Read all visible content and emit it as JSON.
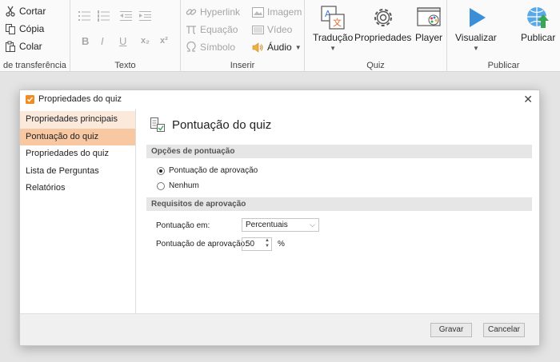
{
  "ribbon": {
    "clipboard": {
      "label": "de transferência",
      "cut": "Cortar",
      "copy": "Cópia",
      "paste": "Colar"
    },
    "text": {
      "label": "Texto",
      "bold": "B",
      "italic": "I",
      "underline": "U",
      "subscript": "x₂",
      "superscript": "x²"
    },
    "insert": {
      "label": "Inserir",
      "hyperlink": "Hyperlink",
      "equation": "Equação",
      "symbol": "Símbolo",
      "image": "Imagem",
      "video": "Vídeo",
      "audio": "Áudio"
    },
    "quiz": {
      "label": "Quiz",
      "translation": "Tradução",
      "properties": "Propriedades",
      "player": "Player"
    },
    "publish": {
      "label": "Publicar",
      "preview": "Visualizar",
      "publish": "Publicar"
    }
  },
  "dialog": {
    "title": "Propriedades do quiz",
    "sidebar": [
      "Propriedades principais",
      "Pontuação do quiz",
      "Propriedades do quiz",
      "Lista de Perguntas",
      "Relatórios"
    ],
    "heading": "Pontuação do quiz",
    "scoring_options": {
      "title": "Opções de pontuação",
      "options": [
        "Pontuação de aprovação",
        "Nenhum"
      ],
      "selected": "Pontuação de aprovação"
    },
    "requirements": {
      "title": "Requisitos de aprovação",
      "score_in_label": "Pontuação em:",
      "score_in_value": "Percentuais",
      "passing_label": "Pontuação de aprovação:",
      "passing_value": "50",
      "unit": "%"
    },
    "buttons": {
      "save": "Gravar",
      "cancel": "Cancelar"
    }
  },
  "colors": {
    "accent": "#f28b22",
    "sidebar_active": "#f8c8a2",
    "sidebar_hover": "#fbe9dc",
    "play_blue": "#3b8fd9",
    "publish_green": "#3aa655"
  }
}
